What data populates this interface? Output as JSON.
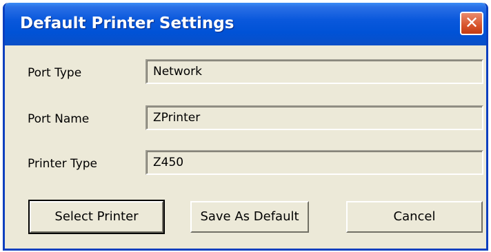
{
  "window": {
    "title": "Default Printer Settings",
    "close_icon": "close-icon"
  },
  "form": {
    "port_type_label": "Port Type",
    "port_type_value": "Network",
    "port_name_label": "Port Name",
    "port_name_value": "ZPrinter",
    "printer_type_label": "Printer Type",
    "printer_type_value": "Z450"
  },
  "buttons": {
    "select_printer": "Select Printer",
    "save_as_default": "Save As Default",
    "cancel": "Cancel"
  },
  "colors": {
    "titlebar": "#0052d6",
    "window_bg": "#ece9d8",
    "close_button": "#d8542c"
  }
}
